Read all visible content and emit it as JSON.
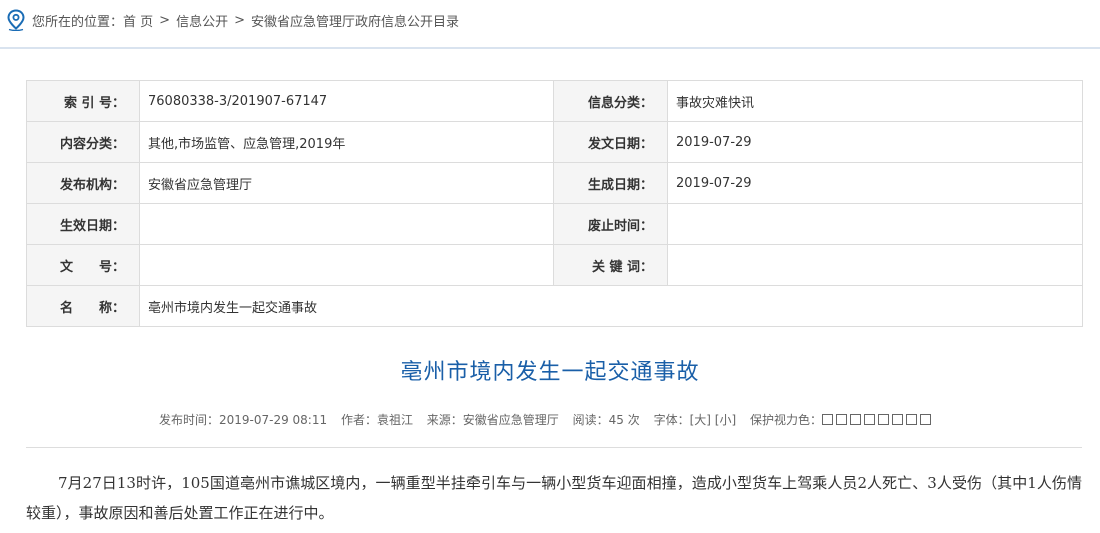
{
  "breadcrumb": {
    "prefix": "您所在的位置：",
    "items": [
      "首 页",
      "信息公开",
      "安徽省应急管理厅政府信息公开目录"
    ],
    "separator": ">"
  },
  "meta": {
    "index_label": "索 引 号：",
    "index_value": "76080338-3/201907-67147",
    "category_label": "信息分类：",
    "category_value": "事故灾难快讯",
    "content_label": "内容分类：",
    "content_value": "其他,市场监管、应急管理,2019年",
    "issue_date_label": "发文日期：",
    "issue_date_value": "2019-07-29",
    "org_label": "发布机构：",
    "org_value": "安徽省应急管理厅",
    "gen_date_label": "生成日期：",
    "gen_date_value": "2019-07-29",
    "effective_label": "生效日期：",
    "effective_value": "",
    "repeal_label": "废止时间：",
    "repeal_value": "",
    "docno_label": "文　　号：",
    "docno_value": "",
    "keywords_label": "关 键 词：",
    "keywords_value": "",
    "name_label": "名　　称：",
    "name_value": "亳州市境内发生一起交通事故"
  },
  "article": {
    "title": "亳州市境内发生一起交通事故",
    "publish_time": "发布时间：2019-07-29 08:11",
    "author": "作者：袁祖江",
    "source": "来源：安徽省应急管理厅",
    "views": "阅读：45 次",
    "font_label": "字体：",
    "font_large": "[大]",
    "font_small": "[小]",
    "eye_label": "保护视力色：",
    "eye_colors": [
      "#ffffff",
      "#ffffff",
      "#ffffff",
      "#ffffff",
      "#ffffff",
      "#ffffff",
      "#ffffff",
      "#ffffff"
    ],
    "body": "7月27日13时许，105国道亳州市谯城区境内，一辆重型半挂牵引车与一辆小型货车迎面相撞，造成小型货车上驾乘人员2人死亡、3人受伤（其中1人伤情较重），事故原因和善后处置工作正在进行中。"
  },
  "colors": {
    "title": "#1a5fa8",
    "label_bg": "#f5f5f5",
    "border": "#dcdcdc",
    "pin_icon": "#1a6cb5"
  },
  "icons": {
    "location": "location-pin-icon"
  }
}
